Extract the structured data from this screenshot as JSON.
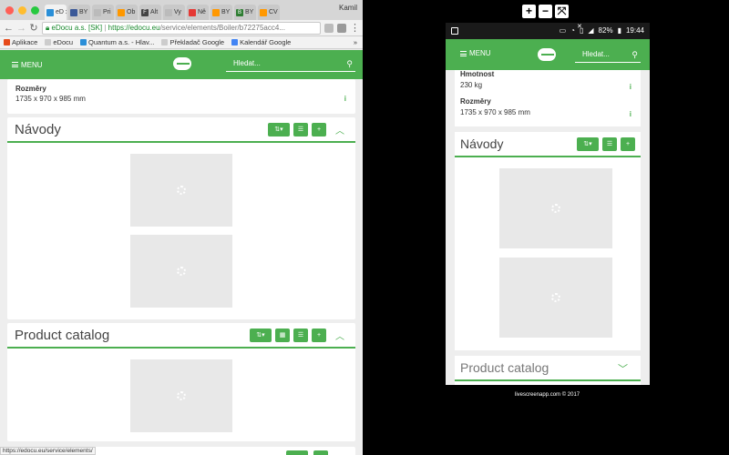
{
  "browser": {
    "tabs": [
      {
        "label": "eD",
        "color": "#2a8fd8",
        "active": true
      },
      {
        "label": "BY",
        "color": "#3b5998"
      },
      {
        "label": "Pri",
        "color": "#bbbbbb"
      },
      {
        "label": "Ob",
        "color": "#ff9800"
      },
      {
        "label": "Alt",
        "color": "#444444",
        "glyph": "F"
      },
      {
        "label": "Vy",
        "color": "#bbbbbb"
      },
      {
        "label": "Ně",
        "color": "#e53935"
      },
      {
        "label": "BY",
        "color": "#ff9800"
      },
      {
        "label": "BY",
        "color": "#2e7d32",
        "glyph": "B"
      },
      {
        "label": "CV",
        "color": "#ff9800"
      }
    ],
    "profile": "Kamil",
    "close_x": "x",
    "address": {
      "secure_label": "eDocu a.s. [SK]",
      "url_host": "https://edocu.eu",
      "url_path": "/service/elements/Boiler/b72275acc4..."
    },
    "bookmarks": [
      {
        "label": "Aplikace",
        "color": "#e64a19"
      },
      {
        "label": "eDocu",
        "color": "#cccccc"
      },
      {
        "label": "Quantum a.s. - Hlav...",
        "color": "#2a8fd8"
      },
      {
        "label": "Překladač Google",
        "color": "#cccccc"
      },
      {
        "label": "Kalendář Google",
        "color": "#4285f4"
      }
    ],
    "bookmarks_more": "»",
    "status_url": "https://edocu.eu/service/elements/"
  },
  "site": {
    "menu_label": "MENU",
    "search_placeholder": "Hledat...",
    "spec_dimensions_label": "Rozměry",
    "spec_dimensions_value": "1735 x 970 x 985 mm",
    "spec_weight_label": "Hmotnost",
    "spec_weight_value": "230 kg",
    "info_icon": "i",
    "section_navody": "Návody",
    "section_catalog": "Product catalog",
    "btn_sort": "⇅▾",
    "btn_list": "☰",
    "btn_add": "+",
    "btn_grid": "▦",
    "collapse": "^",
    "expand": "⌄"
  },
  "phone": {
    "status_battery": "82%",
    "status_time": "19:44",
    "x_mark": "✕"
  },
  "tools": {
    "plus": "+",
    "minus": "−",
    "fit": "⤧"
  },
  "credit": "livescreenapp.com © 2017"
}
